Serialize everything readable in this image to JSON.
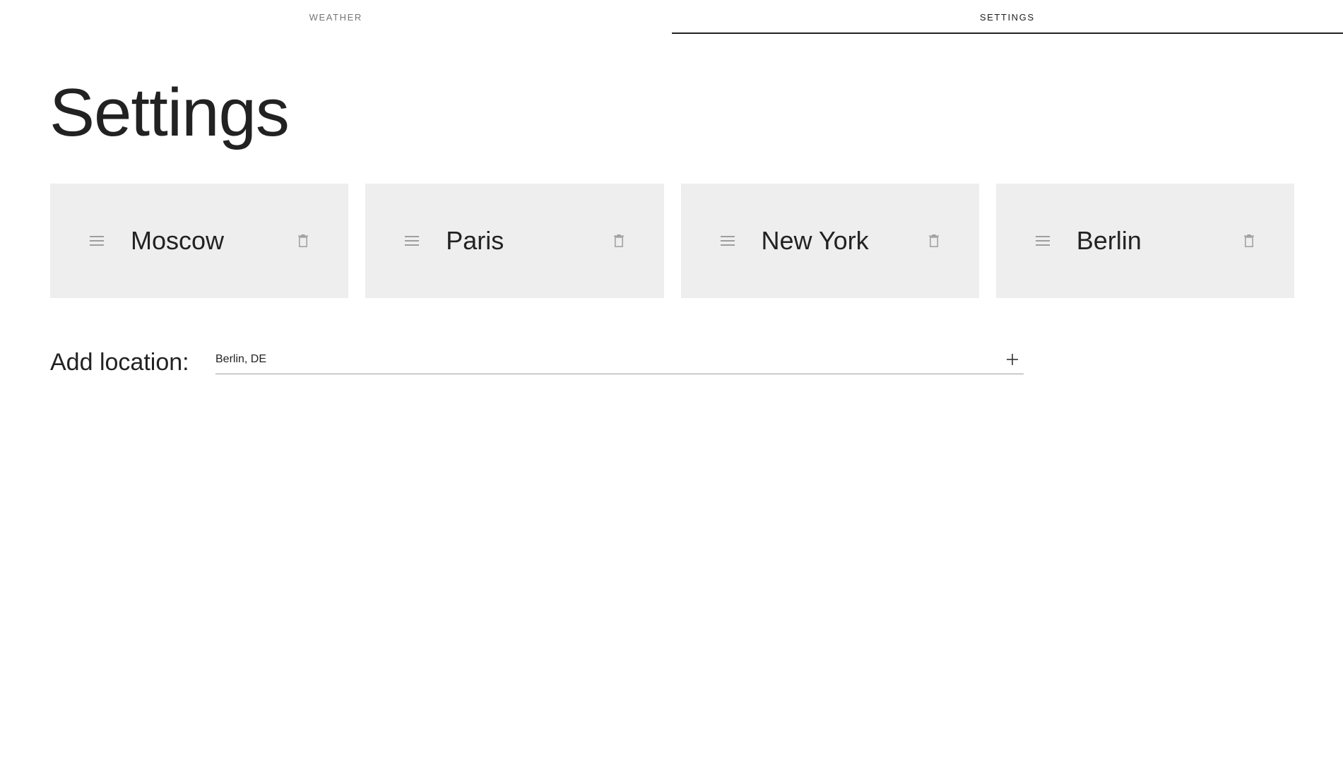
{
  "tabs": [
    {
      "label": "Weather",
      "active": false
    },
    {
      "label": "Settings",
      "active": true
    }
  ],
  "page": {
    "title": "Settings"
  },
  "locations": [
    {
      "name": "Moscow",
      "drag_icon": "drag-handle-icon",
      "delete_icon": "trash-icon"
    },
    {
      "name": "Paris",
      "drag_icon": "drag-handle-icon",
      "delete_icon": "trash-icon"
    },
    {
      "name": "New York",
      "drag_icon": "drag-handle-icon",
      "delete_icon": "trash-icon"
    },
    {
      "name": "Berlin",
      "drag_icon": "drag-handle-icon",
      "delete_icon": "trash-icon"
    }
  ],
  "add_location": {
    "label": "Add location:",
    "value": "Berlin, DE",
    "button_icon": "plus-icon"
  },
  "colors": {
    "card_background": "#eeeeee",
    "text": "#222222",
    "muted_text": "#757575",
    "icon": "#9e9e9e",
    "active_indicator": "#222222"
  }
}
